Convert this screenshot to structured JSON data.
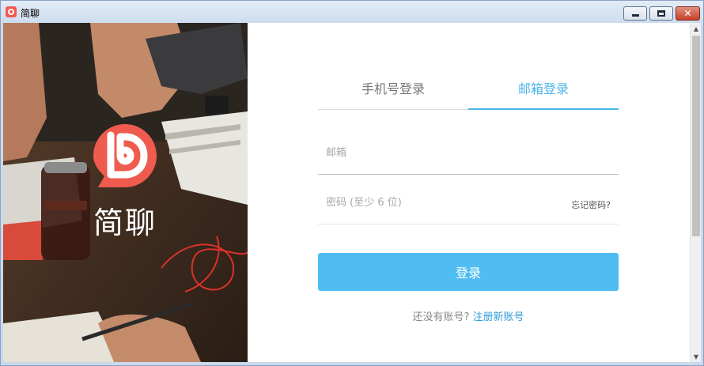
{
  "window": {
    "title": "简聊",
    "controls": {
      "minimize": "minimize",
      "maximize": "maximize",
      "close": "✕"
    }
  },
  "brand": {
    "name": "简聊",
    "logo_color": "#ef5b4f",
    "icon": "chat-logo-icon"
  },
  "tabs": [
    {
      "label": "手机号登录",
      "active": false
    },
    {
      "label": "邮箱登录",
      "active": true
    }
  ],
  "form": {
    "email": {
      "placeholder": "邮箱",
      "value": ""
    },
    "password": {
      "placeholder": "密码 (至少 6 位)",
      "value": ""
    },
    "forgot_label": "忘记密码?",
    "login_label": "登录",
    "register_prompt": "还没有账号? ",
    "register_link": "注册新账号"
  },
  "colors": {
    "accent": "#4cb5ea",
    "button": "#4fbdf2",
    "link": "#2f9bd8"
  }
}
